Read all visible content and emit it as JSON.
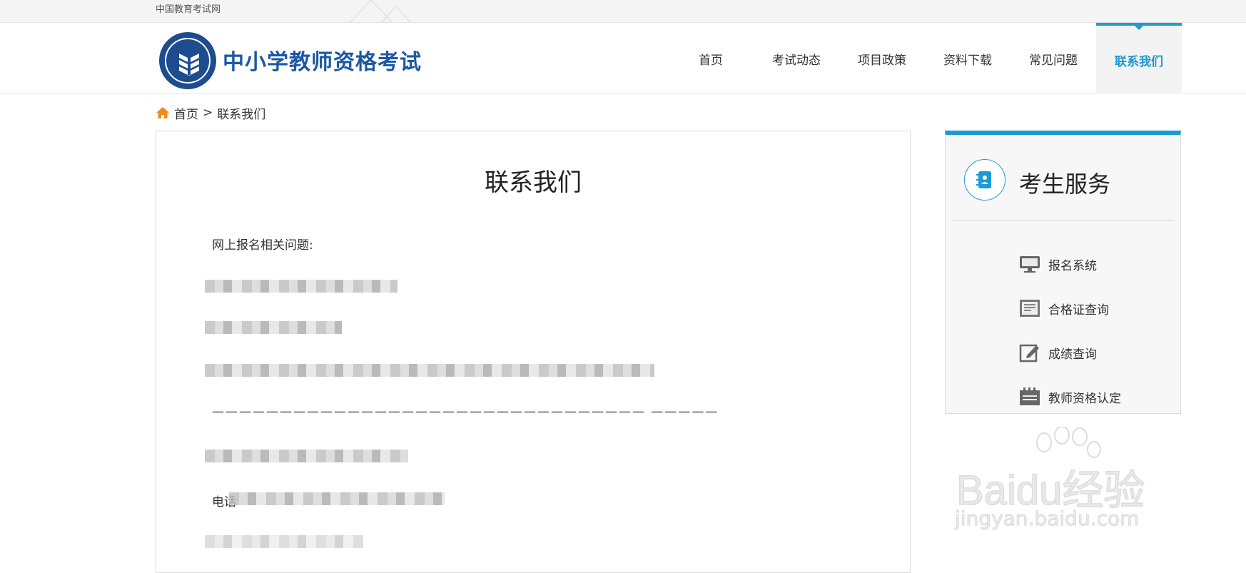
{
  "topbar": {
    "site_name": "中国教育考试网"
  },
  "header": {
    "logo_title": "中小学教师资格考试",
    "nav": [
      {
        "label": "首页",
        "active": false
      },
      {
        "label": "考试动态",
        "active": false
      },
      {
        "label": "项目政策",
        "active": false
      },
      {
        "label": "资料下载",
        "active": false
      },
      {
        "label": "常见问题",
        "active": false
      },
      {
        "label": "联系我们",
        "active": true
      }
    ]
  },
  "breadcrumb": {
    "home": "首页",
    "separator": ">",
    "current": "联系我们"
  },
  "content": {
    "title": "联系我们",
    "section_label": "网上报名相关问题:",
    "divider": "———————————————————————————————— —————",
    "phone_prefix": "电话"
  },
  "sidebar": {
    "title": "考生服务",
    "items": [
      {
        "label": "报名系统",
        "icon": "monitor-icon"
      },
      {
        "label": "合格证查询",
        "icon": "certificate-icon"
      },
      {
        "label": "成绩查询",
        "icon": "edit-icon"
      },
      {
        "label": "教师资格认定",
        "icon": "calendar-icon"
      }
    ]
  },
  "watermark": {
    "text": "Baidu经验",
    "url": "jingyan.baidu.com"
  },
  "colors": {
    "accent": "#1a9ad6",
    "logo_blue": "#1c58a3",
    "home_icon": "#f08a1c"
  }
}
